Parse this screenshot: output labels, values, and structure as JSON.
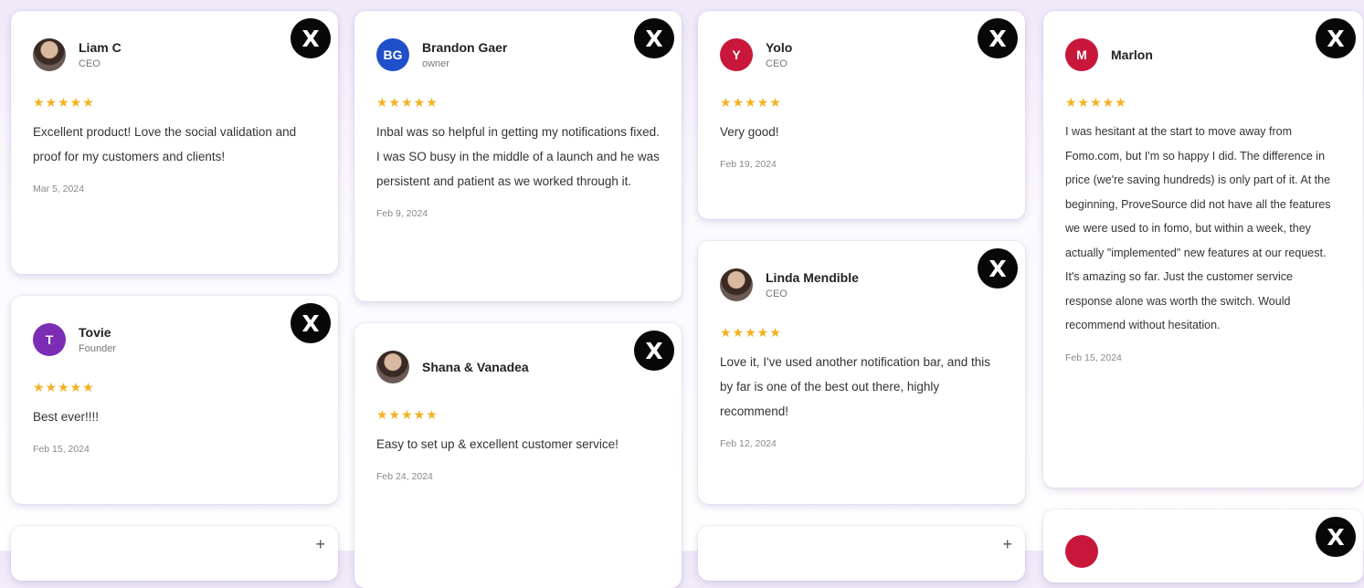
{
  "x_badge_glyph": "X",
  "plus_glyph": "+",
  "columns": [
    {
      "cards": [
        {
          "initials": "",
          "avatar_color": "",
          "name": "Liam C",
          "role": "CEO",
          "stars": "★★★★★",
          "text": "Excellent product! Love the social validation and proof for my customers and clients!",
          "date": "Mar 5, 2024"
        },
        {
          "initials": "T",
          "avatar_color": "#7b2db5",
          "name": "Tovie",
          "role": "Founder",
          "stars": "★★★★★",
          "text": "Best ever!!!!",
          "date": "Feb 15, 2024"
        }
      ]
    },
    {
      "cards": [
        {
          "initials": "BG",
          "avatar_color": "#1f4fc9",
          "name": "Brandon Gaer",
          "role": "owner",
          "stars": "★★★★★",
          "text": "Inbal was so helpful in getting my notifications fixed. I was SO busy in the middle of a launch and he was persistent and patient as we worked through it.",
          "date": "Feb 9, 2024"
        },
        {
          "initials": "",
          "avatar_color": "",
          "name": "Shana & Vanadea",
          "role": "",
          "stars": "★★★★★",
          "text": "Easy to set up & excellent customer service!",
          "date": "Feb 24, 2024"
        }
      ]
    },
    {
      "cards": [
        {
          "initials": "Y",
          "avatar_color": "#c9173b",
          "name": "Yolo",
          "role": "CEO",
          "stars": "★★★★★",
          "text": "Very good!",
          "date": "Feb 19, 2024"
        },
        {
          "initials": "",
          "avatar_color": "",
          "name": "Linda Mendible",
          "role": "CEO",
          "stars": "★★★★★",
          "text": "Love it, I've used another notification bar, and this by far is one of the best out there, highly recommend!",
          "date": "Feb 12, 2024"
        }
      ]
    },
    {
      "cards": [
        {
          "initials": "M",
          "avatar_color": "#c9173b",
          "name": "Marlon",
          "role": "",
          "stars": "★★★★★",
          "text": "I was hesitant at the start to move away from Fomo.com, but I'm so happy I did. The difference in price (we're saving hundreds) is only part of it. At the beginning, ProveSource did not have all the features we were used to in fomo, but within a week, they actually \"implemented\" new features at our request. It's amazing so far. Just the customer service response alone was worth the switch. Would recommend without hesitation.",
          "date": "Feb 15, 2024"
        }
      ]
    }
  ]
}
